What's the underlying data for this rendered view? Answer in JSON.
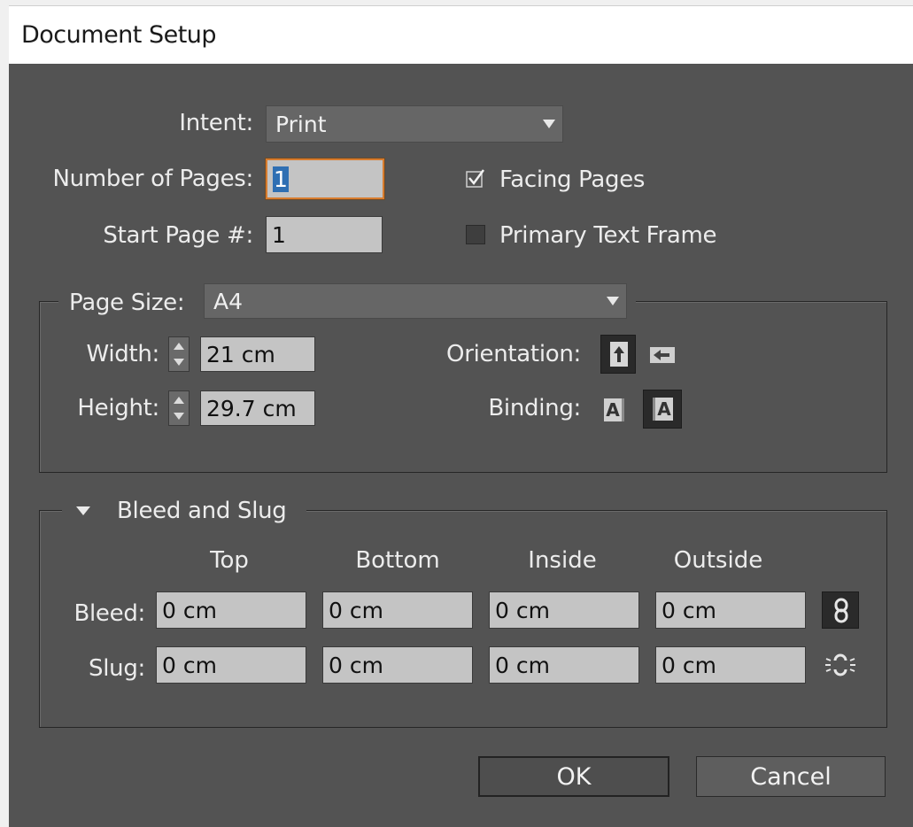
{
  "window": {
    "title": "Document Setup"
  },
  "intent": {
    "label": "Intent:",
    "value": "Print"
  },
  "pages": {
    "number_label": "Number of Pages:",
    "number_value": "1",
    "start_label": "Start Page #:",
    "start_value": "1",
    "facing_label": "Facing Pages",
    "facing_checked": true,
    "primary_label": "Primary Text Frame",
    "primary_checked": false
  },
  "page_size": {
    "label": "Page Size:",
    "value": "A4",
    "width_label": "Width:",
    "width_value": "21 cm",
    "height_label": "Height:",
    "height_value": "29.7 cm",
    "orientation_label": "Orientation:",
    "binding_label": "Binding:",
    "binding_left_glyph": "A",
    "binding_right_glyph": "A"
  },
  "bleed_slug": {
    "title": "Bleed and Slug",
    "columns": [
      "Top",
      "Bottom",
      "Inside",
      "Outside"
    ],
    "bleed_label": "Bleed:",
    "bleed_values": [
      "0 cm",
      "0 cm",
      "0 cm",
      "0 cm"
    ],
    "slug_label": "Slug:",
    "slug_values": [
      "0 cm",
      "0 cm",
      "0 cm",
      "0 cm"
    ]
  },
  "buttons": {
    "ok": "OK",
    "cancel": "Cancel"
  },
  "colors": {
    "panel": "#535353",
    "field": "#c4c4c4",
    "focus_border": "#d87c2e",
    "selection": "#2f6fb3"
  }
}
